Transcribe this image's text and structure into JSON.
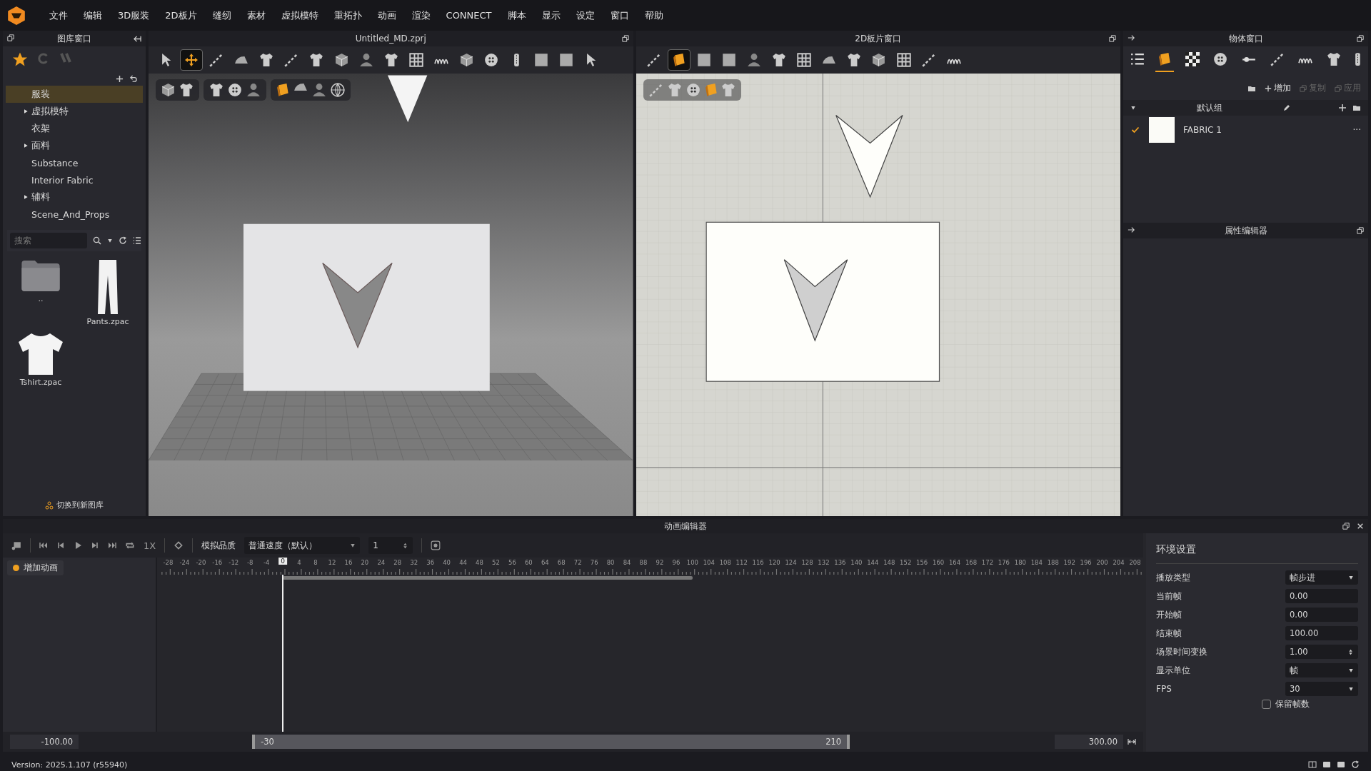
{
  "menu": [
    "文件",
    "编辑",
    "3D服装",
    "2D板片",
    "缝纫",
    "素材",
    "虚拟模特",
    "重拓扑",
    "动画",
    "渲染",
    "CONNECT",
    "脚本",
    "显示",
    "设定",
    "窗口",
    "帮助"
  ],
  "library": {
    "title": "图库窗口",
    "tree": [
      {
        "label": "服装",
        "kind": "item",
        "selected": true
      },
      {
        "label": "虚拟模特",
        "kind": "group",
        "selected": false
      },
      {
        "label": "衣架",
        "kind": "item",
        "selected": false
      },
      {
        "label": "面料",
        "kind": "group",
        "selected": false
      },
      {
        "label": "Substance",
        "kind": "item",
        "selected": false
      },
      {
        "label": "Interior Fabric",
        "kind": "item",
        "selected": false
      },
      {
        "label": "辅料",
        "kind": "group",
        "selected": false
      },
      {
        "label": "Scene_And_Props",
        "kind": "item",
        "selected": false
      }
    ],
    "search": {
      "placeholder": "搜索"
    },
    "files": [
      {
        "label": "..",
        "kind": "folder"
      },
      {
        "label": "Pants.zpac",
        "kind": "pants"
      },
      {
        "label": "Tshirt.zpac",
        "kind": "tshirt"
      }
    ],
    "switch_link": "切换到新图库"
  },
  "viewport_3d": {
    "title": "Untitled_MD.zprj",
    "tools": [
      {
        "selected": false
      },
      {
        "selected": true
      },
      {
        "selected": false
      },
      {
        "selected": false
      },
      {
        "selected": false
      },
      {
        "selected": false
      },
      {
        "selected": false
      },
      {
        "selected": false
      },
      {
        "selected": false
      },
      {
        "selected": false
      },
      {
        "selected": false
      },
      {
        "selected": false
      },
      {
        "selected": false
      },
      {
        "selected": false
      },
      {
        "selected": false
      },
      {
        "selected": false
      },
      {
        "selected": false
      },
      {
        "selected": false
      }
    ]
  },
  "pattern_window": {
    "title": "2D板片窗口",
    "tools": [
      {
        "selected": false
      },
      {
        "selected": true
      },
      {
        "selected": false
      },
      {
        "selected": false
      },
      {
        "selected": false
      },
      {
        "selected": false
      },
      {
        "selected": false
      },
      {
        "selected": false
      },
      {
        "selected": false
      },
      {
        "selected": false
      },
      {
        "selected": false
      },
      {
        "selected": false
      },
      {
        "selected": false
      }
    ]
  },
  "object_window": {
    "title": "物体窗口",
    "tabs": [
      {
        "selected": false
      },
      {
        "selected": true
      },
      {
        "selected": false
      },
      {
        "selected": false
      },
      {
        "selected": false
      },
      {
        "selected": false
      },
      {
        "selected": false
      },
      {
        "selected": false
      },
      {
        "selected": false
      }
    ],
    "actions": [
      {
        "label": "增加",
        "disabled": false
      },
      {
        "label": "复制",
        "disabled": true
      },
      {
        "label": "应用",
        "disabled": true
      }
    ],
    "group": "默认组",
    "fabrics": [
      {
        "name": "FABRIC 1",
        "checked": true,
        "more": "···"
      }
    ]
  },
  "property_editor": {
    "title": "属性编辑器"
  },
  "animation_editor": {
    "title": "动画编辑器",
    "speed": "1X",
    "quality_label": "模拟品质",
    "quality": "普通速度（默认）",
    "step": "1",
    "add_animation": "增加动画",
    "ticks": [
      "-28",
      "-24",
      "-20",
      "-16",
      "-12",
      "-8",
      "-4",
      "4",
      "8",
      "12",
      "16",
      "20",
      "24",
      "28",
      "32",
      "36",
      "40",
      "44",
      "48",
      "52",
      "56",
      "60",
      "64",
      "68",
      "72",
      "76",
      "80",
      "84",
      "88",
      "92",
      "96",
      "100",
      "104",
      "108",
      "112",
      "116",
      "120",
      "124",
      "128",
      "132",
      "136",
      "140",
      "144",
      "148",
      "152",
      "156",
      "160",
      "164",
      "168",
      "172",
      "176",
      "180",
      "184",
      "188",
      "192",
      "196",
      "200",
      "204",
      "208"
    ],
    "playhead": "0",
    "range": {
      "min": "-100.00",
      "start": "-30",
      "end": "210",
      "max": "300.00"
    }
  },
  "environment": {
    "title": "环境设置",
    "rows": [
      {
        "label": "播放类型",
        "value": "帧步进",
        "kind": "dropdown"
      },
      {
        "label": "当前帧",
        "value": "0.00",
        "kind": "field"
      },
      {
        "label": "开始帧",
        "value": "0.00",
        "kind": "field"
      },
      {
        "label": "结束帧",
        "value": "100.00",
        "kind": "field"
      },
      {
        "label": "场景时间变换",
        "value": "1.00",
        "kind": "spinner"
      },
      {
        "label": "显示单位",
        "value": "帧",
        "kind": "dropdown"
      },
      {
        "label": "FPS",
        "value": "30",
        "kind": "dropdown"
      }
    ],
    "keep_frames": {
      "label": "保留帧数",
      "checked": false
    }
  },
  "status_bar": {
    "version": "Version: 2025.1.107 (r55940)"
  }
}
